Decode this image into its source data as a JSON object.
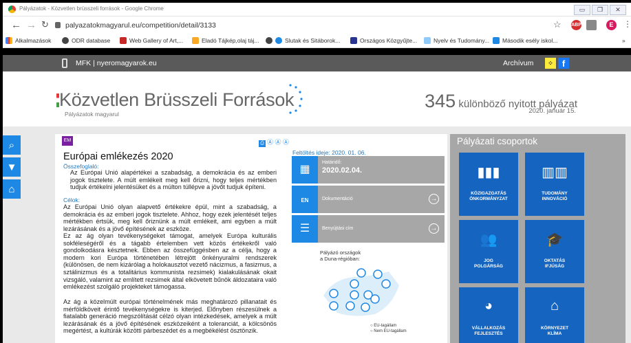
{
  "window": {
    "title": "Pályázatok - Közvetlen brüsszeli források - Google Chrome"
  },
  "browser": {
    "url": "palyazatokmagyarul.eu/competition/detail/3133",
    "bookmarks": [
      "Alkalmazások",
      "ODR database",
      "Web Gallery of Art,...",
      "Eladó Tájkép,olaj táj...",
      "Slutak és Sitáborok...",
      "Országos Közgyűjte...",
      "Nyelv és Tudomány...",
      "Második esély iskol..."
    ],
    "profile_initial": "E",
    "abp": "ABP"
  },
  "site": {
    "topbar_link": "MFK | nyeromagyarok.eu",
    "archive": "Archívum",
    "facebook": "f"
  },
  "header": {
    "logo": "Közvetlen Brüsszeli Források",
    "sublogo": "Pályázatok magyarul",
    "open_count": "345",
    "open_label": "különböző nyitott pályázat",
    "date": "2020. január 15."
  },
  "article": {
    "tag": "EM",
    "title": "Európai emlékezés 2020",
    "summary_label": "Összefoglaló:",
    "summary": "Az Európai Unió alapértékei a szabadság, a demokrácia és az emberi jogok tisztelete. A múlt emlékeit meg kell őrizni, hogy teljes mértékben tudjuk értékelni jelentésüket és a múlton túllépve a jövőt tudjuk építeni.",
    "goals_label": "Célok:",
    "goals_p1": "Az Európai Unió olyan alapvető értékekre épül, mint a szabadság, a demokrácia és az emberi jogok tisztelete. Ahhoz, hogy ezek jelentését teljes mértékben értsük, meg kell őriznünk a múlt emlékeit, ami egyben a múlt lezárásának és a jövő építésének az eszköze.",
    "goals_p2": "Ez az ág olyan tevékenységeket támogat, amelyek Európa kulturális sokféleségéről és a tágabb értelemben vett közös értékekről való gondolkodásra késztetnek. Ebben az összefüggésben az a célja, hogy a modern kori Európa történetében létrejött önkényuralmi rendszerek (különösen, de nem kizárólag a holokausztot vezető nácizmus, a fasizmus, a sztálinizmus és a totalitárius kommunista rezsimek) kialakulásának okait vizsgáló, valamint az említett rezsimek által elkövetett bűnök áldozataira való emlékezést szolgáló projekteket támogassa.",
    "goals_p3": "Az ág a közelmúlt európai történelmének más meghatározó pillanatait és mérföldköveit érintő tevékenységekre is kiterjed. Előnyben részesülnek a fiatalabb generáció megszólítását célzó olyan intézkedések, amelyek a múlt lezárásának és a jövő építésének eszközeiként a toleranciát, a kölcsönös megértést, a kultúrák közötti párbeszédet és a megbékélést ösztönzik."
  },
  "details": {
    "upload_label": "Feltöltés ideje: 2020. 01. 06.",
    "deadline_label": "Határidő:",
    "deadline": "2020.02.04.",
    "docs": "Dokumentáció",
    "submit": "Benyújtási cím",
    "doc_badge": "EN",
    "map_caption": "Pályázó országok\na Duna-régióban:",
    "legend_eu": "EU-tagállam",
    "legend_noneu": "Nem EU-tagállam"
  },
  "groups": {
    "title": "Pályázati csoportok",
    "tiles": [
      {
        "label": "KÖZIGAZGATÁS\nÖNKORMÁNYZAT",
        "icon": "bar-chart-icon"
      },
      {
        "label": "TUDOMÁNY\nINNOVÁCIÓ",
        "icon": "books-icon"
      },
      {
        "label": "JOG\nPOLGÁRSÁG",
        "icon": "people-icon"
      },
      {
        "label": "OKTATÁS\nIFJÚSÁG",
        "icon": "graduation-icon"
      },
      {
        "label": "VÁLLALKOZÁS\nFEJLESZTÉS",
        "icon": "pie-chart-icon"
      },
      {
        "label": "KÖRNYEZET\nKLÍMA",
        "icon": "eco-house-icon"
      }
    ]
  },
  "colors": {
    "blue": "#1e88e5",
    "tile": "#1565c0",
    "gray": "#a7a7a7",
    "purple": "#7b1fa2"
  }
}
